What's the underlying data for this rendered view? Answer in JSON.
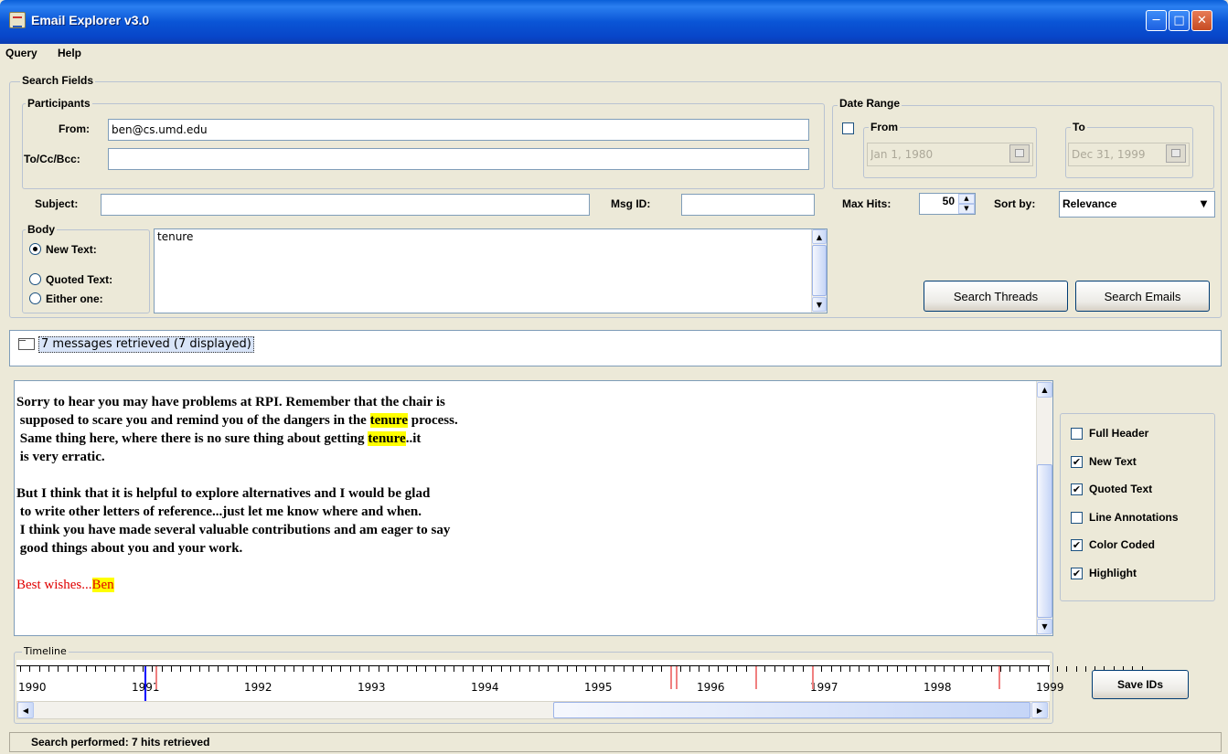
{
  "window": {
    "title": "Email Explorer v3.0"
  },
  "menu": [
    "Query",
    "Help"
  ],
  "search_fields": {
    "legend": "Search Fields",
    "participants": {
      "legend": "Participants",
      "from_label": "From:",
      "from_value": "ben@cs.umd.edu",
      "tocc_label": "To/Cc/Bcc:",
      "tocc_value": ""
    },
    "date_range": {
      "legend": "Date Range",
      "from_label": "From",
      "from_value": "Jan 1, 1980",
      "from_enabled": false,
      "to_label": "To",
      "to_value": "Dec 31, 1999"
    },
    "subject_label": "Subject:",
    "subject_value": "",
    "msgid_label": "Msg ID:",
    "msgid_value": "",
    "maxhits_label": "Max Hits:",
    "maxhits_value": "50",
    "sortby_label": "Sort by:",
    "sortby_value": "Relevance",
    "body": {
      "legend": "Body",
      "options": [
        "New Text:",
        "Quoted Text:",
        "Either one:"
      ],
      "selected": "New Text:",
      "text": "tenure"
    },
    "search_threads_label": "Search Threads",
    "search_emails_label": "Search Emails"
  },
  "results": {
    "summary": "7 messages retrieved (7 displayed)"
  },
  "message": {
    "lines": [
      "Sorry to hear you may have problems at RPI. Remember that the chair is",
      " supposed to scare you and remind you of the dangers in the |tenure| process.",
      " Same thing here, where there is no sure thing about getting |tenure|..it",
      " is very erratic.",
      "",
      "But I think that it is helpful to explore alternatives and I would be glad",
      " to write other letters of reference...just let me know where and when.",
      " I think you have made several valuable contributions and am eager to say",
      " good things about you and your work.",
      ""
    ],
    "highlight_word": "tenure",
    "closing": "Best wishes...",
    "closing_highlight": "Ben",
    "highlight_color": "#FFFF00",
    "quoted_color": "#E00000"
  },
  "options": {
    "items": [
      {
        "label": "Full Header",
        "checked": false
      },
      {
        "label": "New Text",
        "checked": true
      },
      {
        "label": "Quoted Text",
        "checked": true
      },
      {
        "label": "Line Annotations",
        "checked": false
      },
      {
        "label": "Color Coded",
        "checked": true
      },
      {
        "label": "Highlight",
        "checked": true
      }
    ]
  },
  "timeline": {
    "legend": "Timeline",
    "years": [
      "1990",
      "1991",
      "1992",
      "1993",
      "1994",
      "1995",
      "1996",
      "1997",
      "1998",
      "1999"
    ],
    "selected_marker_year": 1991.1,
    "hit_marker_years": [
      1991.2,
      1995.75,
      1995.8,
      1996.5,
      1997.0,
      1998.65
    ],
    "selected_color": "#0000FF",
    "hit_color": "#F08080",
    "save_ids_label": "Save IDs"
  },
  "status": {
    "text": "Search performed: 7 hits retrieved"
  }
}
